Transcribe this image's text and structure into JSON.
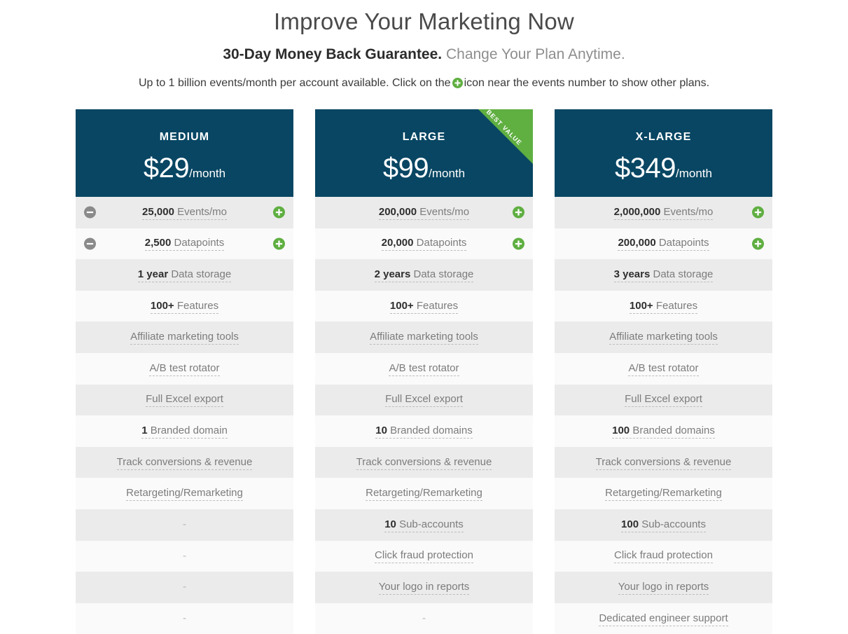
{
  "intro": {
    "headline": "Improve Your Marketing Now",
    "subhead_strong": "30-Day Money Back Guarantee.",
    "subhead_rest": "Change Your Plan Anytime.",
    "note_before": "Up to 1 billion events/month per account available. Click on the",
    "note_after": "icon near the events number to show other plans."
  },
  "colors": {
    "header_navy": "#084663",
    "ribbon_green": "#5faf41",
    "plus_green": "#5faf41",
    "minus_gray": "#8a8a8a",
    "row_shade_a": "#ebebeb",
    "row_shade_b": "#fafafa"
  },
  "ribbon": {
    "label": "BEST VALUE"
  },
  "plans": [
    {
      "name": "MEDIUM",
      "price": "$29",
      "period": "/month",
      "best_value": false,
      "rows": [
        {
          "qty": "25,000",
          "label": "Events/mo",
          "minus": true,
          "plus": true,
          "empty": false
        },
        {
          "qty": "2,500",
          "label": "Datapoints",
          "minus": true,
          "plus": true,
          "empty": false
        },
        {
          "qty": "1 year",
          "label": "Data storage",
          "minus": false,
          "plus": false,
          "empty": false
        },
        {
          "qty": "100+",
          "label": "Features",
          "minus": false,
          "plus": false,
          "empty": false
        },
        {
          "qty": "",
          "label": "Affiliate marketing tools",
          "minus": false,
          "plus": false,
          "empty": false
        },
        {
          "qty": "",
          "label": "A/B test rotator",
          "minus": false,
          "plus": false,
          "empty": false
        },
        {
          "qty": "",
          "label": "Full Excel export",
          "minus": false,
          "plus": false,
          "empty": false
        },
        {
          "qty": "1",
          "label": "Branded domain",
          "minus": false,
          "plus": false,
          "empty": false
        },
        {
          "qty": "",
          "label": "Track conversions & revenue",
          "minus": false,
          "plus": false,
          "empty": false
        },
        {
          "qty": "",
          "label": "Retargeting/Remarketing",
          "minus": false,
          "plus": false,
          "empty": false
        },
        {
          "qty": "",
          "label": "-",
          "minus": false,
          "plus": false,
          "empty": true
        },
        {
          "qty": "",
          "label": "-",
          "minus": false,
          "plus": false,
          "empty": true
        },
        {
          "qty": "",
          "label": "-",
          "minus": false,
          "plus": false,
          "empty": true
        },
        {
          "qty": "",
          "label": "-",
          "minus": false,
          "plus": false,
          "empty": true
        }
      ]
    },
    {
      "name": "LARGE",
      "price": "$99",
      "period": "/month",
      "best_value": true,
      "rows": [
        {
          "qty": "200,000",
          "label": "Events/mo",
          "minus": false,
          "plus": true,
          "empty": false
        },
        {
          "qty": "20,000",
          "label": "Datapoints",
          "minus": false,
          "plus": true,
          "empty": false
        },
        {
          "qty": "2 years",
          "label": "Data storage",
          "minus": false,
          "plus": false,
          "empty": false
        },
        {
          "qty": "100+",
          "label": "Features",
          "minus": false,
          "plus": false,
          "empty": false
        },
        {
          "qty": "",
          "label": "Affiliate marketing tools",
          "minus": false,
          "plus": false,
          "empty": false
        },
        {
          "qty": "",
          "label": "A/B test rotator",
          "minus": false,
          "plus": false,
          "empty": false
        },
        {
          "qty": "",
          "label": "Full Excel export",
          "minus": false,
          "plus": false,
          "empty": false
        },
        {
          "qty": "10",
          "label": "Branded domains",
          "minus": false,
          "plus": false,
          "empty": false
        },
        {
          "qty": "",
          "label": "Track conversions & revenue",
          "minus": false,
          "plus": false,
          "empty": false
        },
        {
          "qty": "",
          "label": "Retargeting/Remarketing",
          "minus": false,
          "plus": false,
          "empty": false
        },
        {
          "qty": "10",
          "label": "Sub-accounts",
          "minus": false,
          "plus": false,
          "empty": false
        },
        {
          "qty": "",
          "label": "Click fraud protection",
          "minus": false,
          "plus": false,
          "empty": false
        },
        {
          "qty": "",
          "label": "Your logo in reports",
          "minus": false,
          "plus": false,
          "empty": false
        },
        {
          "qty": "",
          "label": "-",
          "minus": false,
          "plus": false,
          "empty": true
        }
      ]
    },
    {
      "name": "X-LARGE",
      "price": "$349",
      "period": "/month",
      "best_value": false,
      "rows": [
        {
          "qty": "2,000,000",
          "label": "Events/mo",
          "minus": false,
          "plus": true,
          "empty": false
        },
        {
          "qty": "200,000",
          "label": "Datapoints",
          "minus": false,
          "plus": true,
          "empty": false
        },
        {
          "qty": "3 years",
          "label": "Data storage",
          "minus": false,
          "plus": false,
          "empty": false
        },
        {
          "qty": "100+",
          "label": "Features",
          "minus": false,
          "plus": false,
          "empty": false
        },
        {
          "qty": "",
          "label": "Affiliate marketing tools",
          "minus": false,
          "plus": false,
          "empty": false
        },
        {
          "qty": "",
          "label": "A/B test rotator",
          "minus": false,
          "plus": false,
          "empty": false
        },
        {
          "qty": "",
          "label": "Full Excel export",
          "minus": false,
          "plus": false,
          "empty": false
        },
        {
          "qty": "100",
          "label": "Branded domains",
          "minus": false,
          "plus": false,
          "empty": false
        },
        {
          "qty": "",
          "label": "Track conversions & revenue",
          "minus": false,
          "plus": false,
          "empty": false
        },
        {
          "qty": "",
          "label": "Retargeting/Remarketing",
          "minus": false,
          "plus": false,
          "empty": false
        },
        {
          "qty": "100",
          "label": "Sub-accounts",
          "minus": false,
          "plus": false,
          "empty": false
        },
        {
          "qty": "",
          "label": "Click fraud protection",
          "minus": false,
          "plus": false,
          "empty": false
        },
        {
          "qty": "",
          "label": "Your logo in reports",
          "minus": false,
          "plus": false,
          "empty": false
        },
        {
          "qty": "",
          "label": "Dedicated engineer support",
          "minus": false,
          "plus": false,
          "empty": false
        }
      ]
    }
  ]
}
